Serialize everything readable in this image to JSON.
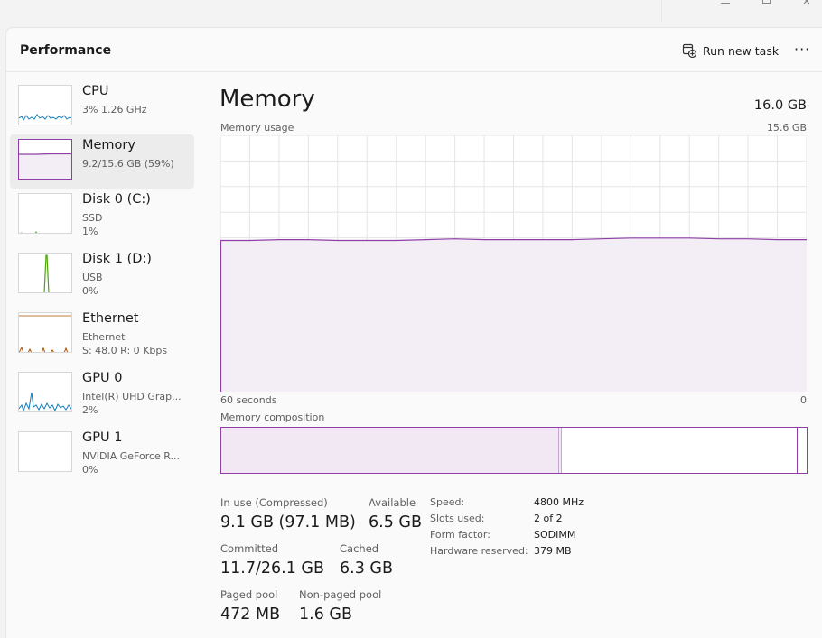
{
  "window": {
    "minimize": "—",
    "maximize": "□",
    "close": "✕"
  },
  "header": {
    "title": "Performance",
    "run_new_task": "Run new task",
    "more": "···"
  },
  "sidebar": {
    "items": [
      {
        "name": "CPU",
        "sub1": "3% 1.26 GHz"
      },
      {
        "name": "Memory",
        "sub1": "9.2/15.6 GB (59%)"
      },
      {
        "name": "Disk 0 (C:)",
        "sub1": "SSD",
        "sub2": "1%"
      },
      {
        "name": "Disk 1 (D:)",
        "sub1": "USB",
        "sub2": "0%"
      },
      {
        "name": "Ethernet",
        "sub1": "Ethernet",
        "sub2": "S: 48.0  R: 0 Kbps"
      },
      {
        "name": "GPU 0",
        "sub1": "Intel(R) UHD Grap...",
        "sub2": "2%"
      },
      {
        "name": "GPU 1",
        "sub1": "NVIDIA GeForce R...",
        "sub2": "0%"
      }
    ]
  },
  "main": {
    "title": "Memory",
    "total": "16.0 GB",
    "usage_label": "Memory usage",
    "usage_max": "15.6 GB",
    "time_label": "60 seconds",
    "time_min": "0",
    "composition_label": "Memory composition",
    "composition": {
      "in_use_fraction": 0.58,
      "total_gb": 15.6
    }
  },
  "stats": {
    "in_use_label": "In use (Compressed)",
    "in_use_value": "9.1 GB (97.1 MB)",
    "available_label": "Available",
    "available_value": "6.5 GB",
    "committed_label": "Committed",
    "committed_value": "11.7/26.1 GB",
    "cached_label": "Cached",
    "cached_value": "6.3 GB",
    "paged_label": "Paged pool",
    "paged_value": "472 MB",
    "nonpaged_label": "Non-paged pool",
    "nonpaged_value": "1.6 GB"
  },
  "specs": {
    "speed_label": "Speed:",
    "speed_value": "4800 MHz",
    "slots_label": "Slots used:",
    "slots_value": "2 of 2",
    "form_label": "Form factor:",
    "form_value": "SODIMM",
    "hw_label": "Hardware reserved:",
    "hw_value": "379 MB"
  },
  "chart_data": {
    "type": "area",
    "xlabel": "60 seconds",
    "ylabel": "Memory usage",
    "xlim": [
      60,
      0
    ],
    "ylim": [
      0,
      15.6
    ],
    "grid": true,
    "x": [
      60,
      57,
      54,
      51,
      48,
      45,
      42,
      39,
      36,
      33,
      30,
      27,
      24,
      21,
      18,
      15,
      12,
      9,
      6,
      3,
      0
    ],
    "series": [
      {
        "values": [
          9.2,
          9.2,
          9.25,
          9.25,
          9.2,
          9.2,
          9.2,
          9.25,
          9.3,
          9.25,
          9.25,
          9.25,
          9.25,
          9.3,
          9.35,
          9.35,
          9.35,
          9.3,
          9.3,
          9.25,
          9.25
        ]
      }
    ],
    "colors": {
      "line": "#8e3fa5",
      "fill": "#f3edf5",
      "grid": "#e5e5e5"
    }
  }
}
